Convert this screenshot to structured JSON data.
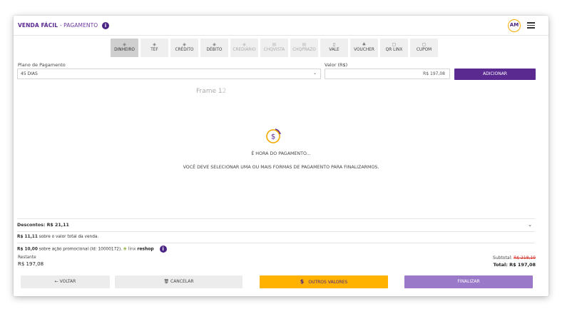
{
  "header": {
    "title": "VENDA FÁCIL",
    "subtitle": "PAGAMENTO",
    "info": "i",
    "avatar": "AM"
  },
  "methods": [
    {
      "label": "DINHEIRO",
      "icon": "cash-icon",
      "glyph": "◈",
      "state": "active"
    },
    {
      "label": "TEF",
      "icon": "card-icon",
      "glyph": "◈",
      "state": "enabled"
    },
    {
      "label": "CRÉDITO",
      "icon": "card-icon",
      "glyph": "◈",
      "state": "enabled"
    },
    {
      "label": "DÉBITO",
      "icon": "card-icon",
      "glyph": "◈",
      "state": "enabled"
    },
    {
      "label": "CREDIÁRIO",
      "icon": "card-icon",
      "glyph": "◈",
      "state": "disabled"
    },
    {
      "label": "CHQVISTA",
      "icon": "check-icon",
      "glyph": "▤",
      "state": "disabled"
    },
    {
      "label": "CHQPRAZO",
      "icon": "check-icon",
      "glyph": "▤",
      "state": "disabled"
    },
    {
      "label": "VALE",
      "icon": "voucher-icon",
      "glyph": "▯",
      "state": "enabled"
    },
    {
      "label": "VOUCHER",
      "icon": "voucher-icon",
      "glyph": "♣",
      "state": "enabled"
    },
    {
      "label": "QR LINX",
      "icon": "qr-icon",
      "glyph": "▢",
      "state": "enabled"
    },
    {
      "label": "CUPOM",
      "icon": "coupon-icon",
      "glyph": "▢",
      "state": "enabled"
    }
  ],
  "form": {
    "plan_label": "Plano de Pagamento",
    "plan_value": "45 DIAS",
    "value_label": "Valor (R$)",
    "value_value": "R$ 197,08",
    "add_button": "ADICIONAR"
  },
  "frame_label": {
    "text": "Frame 1",
    "num": "2"
  },
  "empty_state": {
    "title": "É HORA DO PAGAMENTO...",
    "message": "VOCÊ DEVE SELECIONAR UMA OU MAIS FORMAS DE PAGAMENTO PARA FINALIZARMOS."
  },
  "discounts": {
    "label": "Descontos: R$ 21,11",
    "line1_amount": "R$ 11,11",
    "line1_text": " sobre o valor total da venda.",
    "line2_amount": "R$ 10,00",
    "line2_text": " sobre ação promocional (Id: 10000172). ",
    "linx_text": "linx ",
    "reshop_text": "reshop"
  },
  "summary": {
    "restante_label": "Restante",
    "restante_value": "R$ 197,08",
    "subtotal_label": "Subtotal: ",
    "subtotal_value": "R$ 218,19",
    "total_label": "Total: R$ 197,08"
  },
  "actions": {
    "back": "← VOLTAR",
    "cancel": "CANCELAR",
    "other": "OUTROS VALORES",
    "finalize": "FINALIZAR"
  },
  "colors": {
    "brand": "#5a2a90",
    "accent": "#ffb300",
    "finalize": "#9b79c9",
    "strike": "#d9302c"
  }
}
